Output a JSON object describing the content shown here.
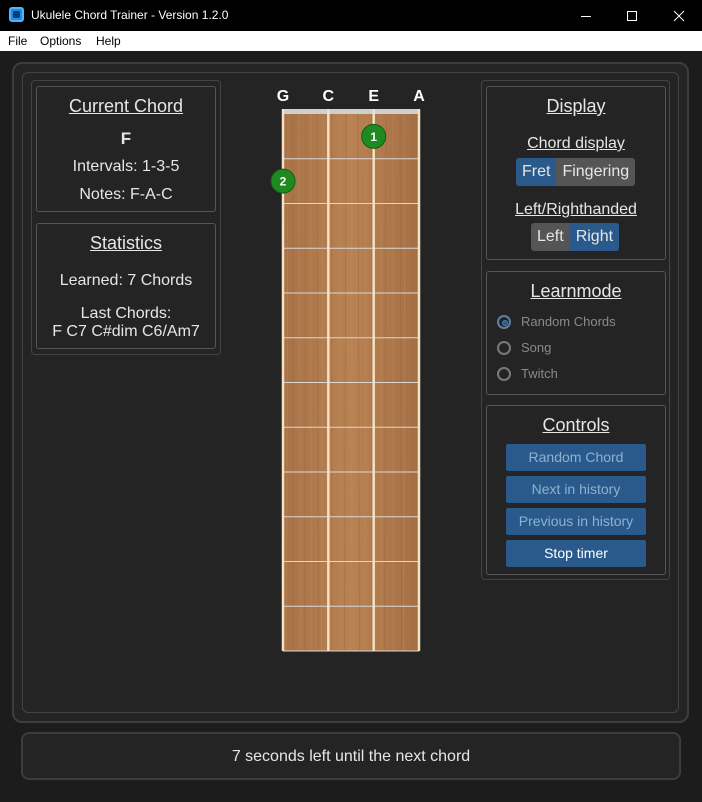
{
  "window": {
    "title": "Ukulele Chord Trainer - Version 1.2.0"
  },
  "menu": [
    "File",
    "Options",
    "Help"
  ],
  "current_chord": {
    "heading": "Current Chord",
    "name": "F",
    "intervals": "Intervals: 1-3-5",
    "notes": "Notes: F-A-C"
  },
  "statistics": {
    "heading": "Statistics",
    "learned": "Learned: 7 Chords",
    "last_heading": "Last Chords:",
    "last_chords": "F C7 C#dim C6/Am7"
  },
  "fretboard": {
    "strings": [
      "G",
      "C",
      "E",
      "A"
    ],
    "frets": 12,
    "fingers": [
      {
        "label": "1",
        "string": "E",
        "fret": 1
      },
      {
        "label": "2",
        "string": "G",
        "fret": 2
      }
    ],
    "wood_color": "#b07a4c",
    "finger_color": "#1f8a1f"
  },
  "display": {
    "heading": "Display",
    "chord_display_label": "Chord display",
    "chord_display_options": [
      "Fret",
      "Fingering"
    ],
    "chord_display_selected": "Fret",
    "hand_label": "Left/Righthanded",
    "hand_options": [
      "Left",
      "Right"
    ],
    "hand_selected": "Right"
  },
  "learnmode": {
    "heading": "Learnmode",
    "options": [
      "Random Chords",
      "Song",
      "Twitch"
    ],
    "selected": "Random Chords"
  },
  "controls": {
    "heading": "Controls",
    "random_chord": "Random Chord",
    "next_history": "Next in history",
    "previous_history": "Previous in history",
    "stop_timer": "Stop timer"
  },
  "status": {
    "message": "7 seconds left until the next chord"
  },
  "colors": {
    "accent": "#2a5a8c",
    "background": "#242424"
  }
}
